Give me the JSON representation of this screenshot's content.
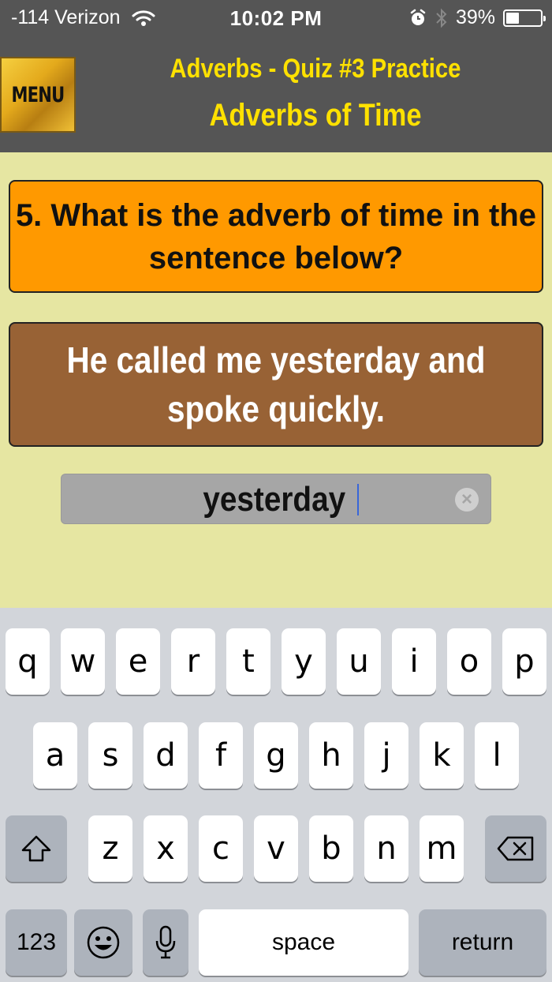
{
  "status": {
    "carrier": "-114 Verizon",
    "time": "10:02 PM",
    "battery_text": "39%",
    "battery_level": 0.39
  },
  "header": {
    "menu_label": "MENU",
    "title": "Adverbs - Quiz #3 Practice",
    "subtitle": "Adverbs of Time"
  },
  "quiz": {
    "question": "5. What is the adverb of time in the sentence below?",
    "sentence": "He called me yesterday and spoke quickly.",
    "answer_value": "yesterday"
  },
  "keyboard": {
    "row1": [
      "q",
      "w",
      "e",
      "r",
      "t",
      "y",
      "u",
      "i",
      "o",
      "p"
    ],
    "row2": [
      "a",
      "s",
      "d",
      "f",
      "g",
      "h",
      "j",
      "k",
      "l"
    ],
    "row3": [
      "z",
      "x",
      "c",
      "v",
      "b",
      "n",
      "m"
    ],
    "numbers_label": "123",
    "space_label": "space",
    "return_label": "return"
  },
  "colors": {
    "header_bg": "#555555",
    "title_yellow": "#ffe100",
    "page_bg": "#e6e6a2",
    "question_bg": "#ff9900",
    "sentence_bg": "#986235"
  },
  "icons": [
    "wifi-icon",
    "alarm-icon",
    "bluetooth-icon",
    "battery-icon",
    "clear-icon",
    "shift-icon",
    "delete-icon",
    "emoji-icon",
    "microphone-icon"
  ]
}
